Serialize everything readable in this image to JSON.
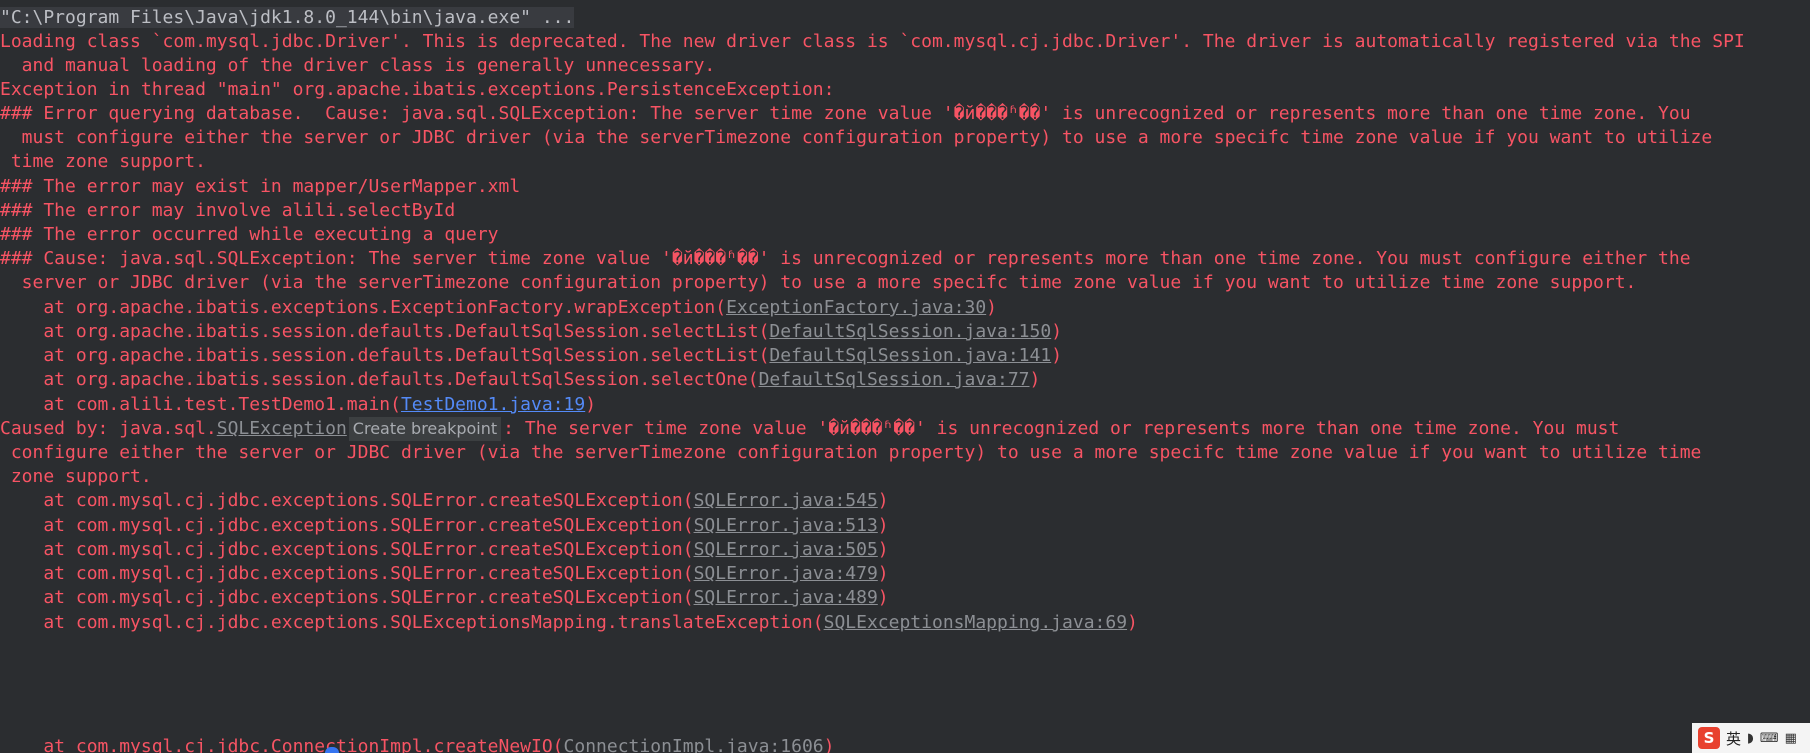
{
  "console": {
    "command": "\"C:\\Program Files\\Java\\jdk1.8.0_144\\bin\\java.exe\" ...",
    "l1": "Loading class `com.mysql.jdbc.Driver'. This is deprecated. The new driver class is `com.mysql.cj.jdbc.Driver'. The driver is automatically registered via the SPI",
    "l2": "  and manual loading of the driver class is generally unnecessary.",
    "l3": "Exception in thread \"main\" org.apache.ibatis.exceptions.PersistenceException:",
    "l4": "### Error querying database.  Cause: java.sql.SQLException: The server time zone value '�й���ʱ��' is unrecognized or represents more than one time zone. You",
    "l5": "  must configure either the server or JDBC driver (via the serverTimezone configuration property) to use a more specifc time zone value if you want to utilize",
    "l6": " time zone support.",
    "l7": "### The error may exist in mapper/UserMapper.xml",
    "l8": "### The error may involve alili.selectById",
    "l9": "### The error occurred while executing a query",
    "l10": "### Cause: java.sql.SQLException: The server time zone value '�й���ʱ��' is unrecognized or represents more than one time zone. You must configure either the",
    "l11": "  server or JDBC driver (via the serverTimezone configuration property) to use a more specifc time zone value if you want to utilize time zone support.",
    "s1_pre": "    at org.apache.ibatis.exceptions.ExceptionFactory.wrapException(",
    "s1_link": "ExceptionFactory.java:30",
    "s2_pre": "    at org.apache.ibatis.session.defaults.DefaultSqlSession.selectList(",
    "s2_link": "DefaultSqlSession.java:150",
    "s3_pre": "    at org.apache.ibatis.session.defaults.DefaultSqlSession.selectList(",
    "s3_link": "DefaultSqlSession.java:141",
    "s4_pre": "    at org.apache.ibatis.session.defaults.DefaultSqlSession.selectOne(",
    "s4_link": "DefaultSqlSession.java:77",
    "s5_pre": "    at com.alili.test.TestDemo1.main(",
    "s5_link": "TestDemo1.java:19",
    "close_paren": ")",
    "c1_pre": "Caused by: java.sql.",
    "c1_link": "SQLException",
    "tooltip": "Create breakpoint",
    "c1_post": ": The server time zone value '�й���ʱ��' is unrecognized or represents more than one time zone. You must",
    "c2": " configure either the server or JDBC driver (via the serverTimezone configuration property) to use a more specifc time zone value if you want to utilize time",
    "c3": " zone support.",
    "t1_pre": "    at com.mysql.cj.jdbc.exceptions.SQLError.createSQLException(",
    "t1_link": "SQLError.java:545",
    "t2_pre": "    at com.mysql.cj.jdbc.exceptions.SQLError.createSQLException(",
    "t2_link": "SQLError.java:513",
    "t3_pre": "    at com.mysql.cj.jdbc.exceptions.SQLError.createSQLException(",
    "t3_link": "SQLError.java:505",
    "t4_pre": "    at com.mysql.cj.jdbc.exceptions.SQLError.createSQLException(",
    "t4_link": "SQLError.java:479",
    "t5_pre": "    at com.mysql.cj.jdbc.exceptions.SQLError.createSQLException(",
    "t5_link": "SQLError.java:489",
    "t6_pre": "    at com.mysql.cj.jdbc.exceptions.SQLExceptionsMapping.translateException(",
    "t6_link": "SQLExceptionsMapping.java:69",
    "t7_pre": "    at com.mysql.cj.jdbc.ConnectionImpl.createNewIO(",
    "t7_link": "ConnectionImpl.java:1606"
  },
  "ime": {
    "logo": "S",
    "lang": "英",
    "icons": [
      "moon-punct-icon",
      "keyboard-icon",
      "grid-icon"
    ]
  },
  "colors": {
    "background": "#2b2d30",
    "error_text": "#f75464",
    "command_text": "#bcbec4",
    "link_text": "#8c8f94",
    "link_blue": "#548af7"
  }
}
